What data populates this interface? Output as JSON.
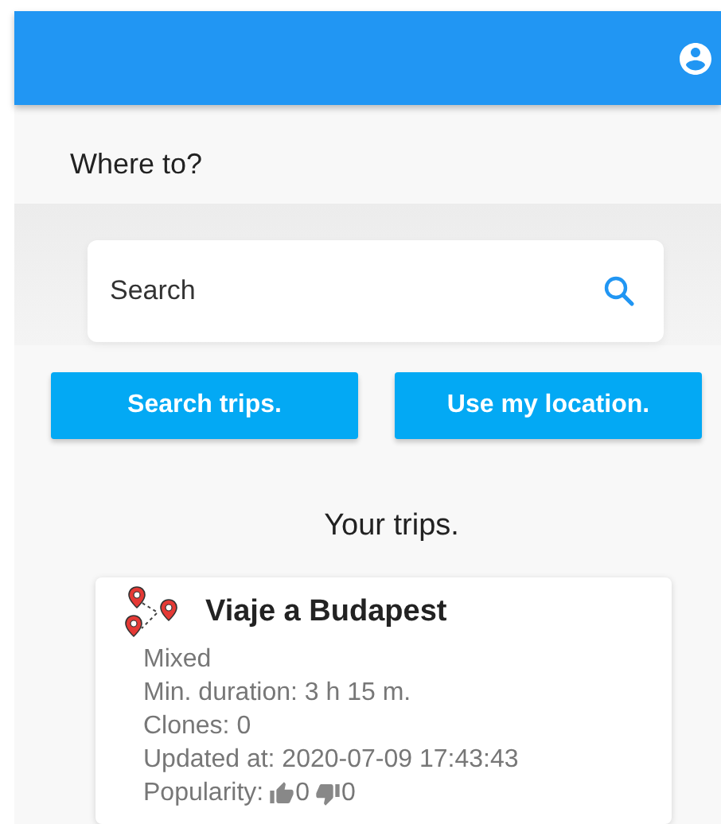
{
  "prompt": "Where to?",
  "search": {
    "placeholder": "Search"
  },
  "buttons": [
    {
      "label": "Search trips."
    },
    {
      "label": "Use my location."
    }
  ],
  "section_title": "Your trips.",
  "trips": [
    {
      "title": "Viaje a Budapest",
      "details": [
        "Mixed",
        "Min. duration: 3 h 15 m.",
        "Clones: 0",
        "Updated at: 2020-07-09 17:43:43"
      ],
      "popularity_label": "Popularity:",
      "likes": "0",
      "dislikes": "0"
    }
  ]
}
